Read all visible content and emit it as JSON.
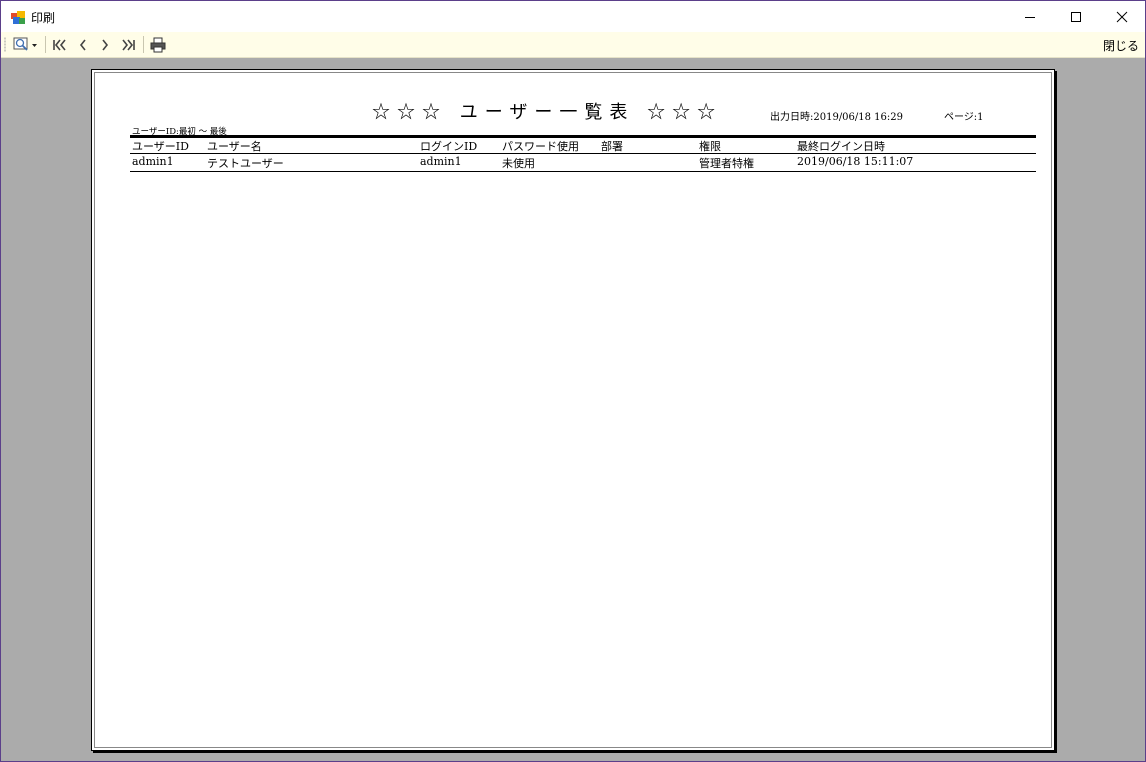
{
  "window": {
    "title": "印刷"
  },
  "toolbar": {
    "close_label": "閉じる"
  },
  "report": {
    "title": "☆☆☆ ユーザー一覧表 ☆☆☆",
    "output_datetime": "出力日時:2019/06/18 16:29",
    "page": "ページ:1",
    "range": "ユーザーID:最初 ～ 最後",
    "columns": [
      "ユーザーID",
      "ユーザー名",
      "ログインID",
      "パスワード使用",
      "部署",
      "権限",
      "最終ログイン日時"
    ],
    "rows": [
      [
        "admin1",
        "テストユーザー",
        "admin1",
        "未使用",
        "",
        "管理者特権",
        "2019/06/18 15:11:07"
      ]
    ]
  }
}
